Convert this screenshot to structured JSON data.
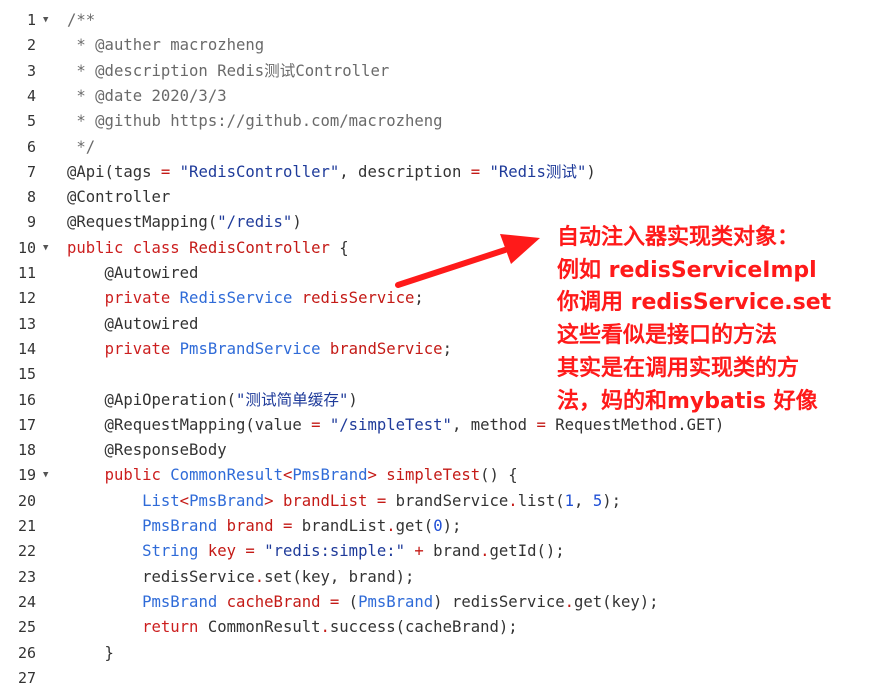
{
  "colors": {
    "keyword": "#cc1f1f",
    "type": "#2f6bd8",
    "string": "#1f3b9a",
    "comment": "#6a6a6a",
    "annotation_text": "#ff1a1a"
  },
  "code_lines": [
    {
      "num": "1",
      "fold": true,
      "tokens": [
        {
          "t": "/**",
          "c": "comment"
        }
      ]
    },
    {
      "num": "2",
      "fold": false,
      "tokens": [
        {
          "t": " * @auther macrozheng",
          "c": "comment"
        }
      ]
    },
    {
      "num": "3",
      "fold": false,
      "tokens": [
        {
          "t": " * @description Redis测试Controller",
          "c": "comment"
        }
      ]
    },
    {
      "num": "4",
      "fold": false,
      "tokens": [
        {
          "t": " * @date 2020/3/3",
          "c": "comment"
        }
      ]
    },
    {
      "num": "5",
      "fold": false,
      "tokens": [
        {
          "t": " * @github https://github.com/macrozheng",
          "c": "comment"
        }
      ]
    },
    {
      "num": "6",
      "fold": false,
      "tokens": [
        {
          "t": " */",
          "c": "comment"
        }
      ]
    },
    {
      "num": "7",
      "fold": false,
      "tokens": [
        {
          "t": "@Api(tags ",
          "c": "annot"
        },
        {
          "t": "=",
          "c": "cls"
        },
        {
          "t": " ",
          "c": "plain"
        },
        {
          "t": "\"RedisController\"",
          "c": "str"
        },
        {
          "t": ", description ",
          "c": "plain"
        },
        {
          "t": "=",
          "c": "cls"
        },
        {
          "t": " ",
          "c": "plain"
        },
        {
          "t": "\"Redis测试\"",
          "c": "str"
        },
        {
          "t": ")",
          "c": "plain"
        }
      ]
    },
    {
      "num": "8",
      "fold": false,
      "tokens": [
        {
          "t": "@Controller",
          "c": "annot"
        }
      ]
    },
    {
      "num": "9",
      "fold": false,
      "tokens": [
        {
          "t": "@RequestMapping(",
          "c": "annot"
        },
        {
          "t": "\"/redis\"",
          "c": "str"
        },
        {
          "t": ")",
          "c": "plain"
        }
      ]
    },
    {
      "num": "10",
      "fold": true,
      "tokens": [
        {
          "t": "public",
          "c": "kw"
        },
        {
          "t": " ",
          "c": "plain"
        },
        {
          "t": "class",
          "c": "kw"
        },
        {
          "t": " ",
          "c": "plain"
        },
        {
          "t": "RedisController",
          "c": "cls"
        },
        {
          "t": " {",
          "c": "plain"
        }
      ]
    },
    {
      "num": "11",
      "fold": false,
      "tokens": [
        {
          "t": "    @Autowired",
          "c": "annot"
        }
      ]
    },
    {
      "num": "12",
      "fold": false,
      "tokens": [
        {
          "t": "    ",
          "c": "plain"
        },
        {
          "t": "private",
          "c": "kw"
        },
        {
          "t": " ",
          "c": "plain"
        },
        {
          "t": "RedisService",
          "c": "type"
        },
        {
          "t": " ",
          "c": "plain"
        },
        {
          "t": "redisService",
          "c": "field"
        },
        {
          "t": ";",
          "c": "plain"
        }
      ]
    },
    {
      "num": "13",
      "fold": false,
      "tokens": [
        {
          "t": "    @Autowired",
          "c": "annot"
        }
      ]
    },
    {
      "num": "14",
      "fold": false,
      "tokens": [
        {
          "t": "    ",
          "c": "plain"
        },
        {
          "t": "private",
          "c": "kw"
        },
        {
          "t": " ",
          "c": "plain"
        },
        {
          "t": "PmsBrandService",
          "c": "type"
        },
        {
          "t": " ",
          "c": "plain"
        },
        {
          "t": "brandService",
          "c": "field"
        },
        {
          "t": ";",
          "c": "plain"
        }
      ]
    },
    {
      "num": "15",
      "fold": false,
      "tokens": []
    },
    {
      "num": "16",
      "fold": false,
      "tokens": [
        {
          "t": "    @ApiOperation(",
          "c": "annot"
        },
        {
          "t": "\"测试简单缓存\"",
          "c": "str"
        },
        {
          "t": ")",
          "c": "plain"
        }
      ]
    },
    {
      "num": "17",
      "fold": false,
      "tokens": [
        {
          "t": "    @RequestMapping(value ",
          "c": "annot"
        },
        {
          "t": "=",
          "c": "cls"
        },
        {
          "t": " ",
          "c": "plain"
        },
        {
          "t": "\"/simpleTest\"",
          "c": "str"
        },
        {
          "t": ", method ",
          "c": "plain"
        },
        {
          "t": "=",
          "c": "cls"
        },
        {
          "t": " RequestMethod.GET)",
          "c": "plain"
        }
      ]
    },
    {
      "num": "18",
      "fold": false,
      "tokens": [
        {
          "t": "    @ResponseBody",
          "c": "annot"
        }
      ]
    },
    {
      "num": "19",
      "fold": true,
      "tokens": [
        {
          "t": "    ",
          "c": "plain"
        },
        {
          "t": "public",
          "c": "kw"
        },
        {
          "t": " ",
          "c": "plain"
        },
        {
          "t": "CommonResult",
          "c": "type"
        },
        {
          "t": "<",
          "c": "cls"
        },
        {
          "t": "PmsBrand",
          "c": "type"
        },
        {
          "t": ">",
          "c": "cls"
        },
        {
          "t": " ",
          "c": "plain"
        },
        {
          "t": "simpleTest",
          "c": "method"
        },
        {
          "t": "() {",
          "c": "plain"
        }
      ]
    },
    {
      "num": "20",
      "fold": false,
      "tokens": [
        {
          "t": "        ",
          "c": "plain"
        },
        {
          "t": "List",
          "c": "type"
        },
        {
          "t": "<",
          "c": "cls"
        },
        {
          "t": "PmsBrand",
          "c": "type"
        },
        {
          "t": ">",
          "c": "cls"
        },
        {
          "t": " ",
          "c": "plain"
        },
        {
          "t": "brandList",
          "c": "field"
        },
        {
          "t": " ",
          "c": "plain"
        },
        {
          "t": "=",
          "c": "cls"
        },
        {
          "t": " brandService",
          "c": "plain"
        },
        {
          "t": ".",
          "c": "cls"
        },
        {
          "t": "list(",
          "c": "plain"
        },
        {
          "t": "1",
          "c": "num"
        },
        {
          "t": ", ",
          "c": "plain"
        },
        {
          "t": "5",
          "c": "num"
        },
        {
          "t": ");",
          "c": "plain"
        }
      ]
    },
    {
      "num": "21",
      "fold": false,
      "tokens": [
        {
          "t": "        ",
          "c": "plain"
        },
        {
          "t": "PmsBrand",
          "c": "type"
        },
        {
          "t": " ",
          "c": "plain"
        },
        {
          "t": "brand",
          "c": "field"
        },
        {
          "t": " ",
          "c": "plain"
        },
        {
          "t": "=",
          "c": "cls"
        },
        {
          "t": " brandList",
          "c": "plain"
        },
        {
          "t": ".",
          "c": "cls"
        },
        {
          "t": "get(",
          "c": "plain"
        },
        {
          "t": "0",
          "c": "num"
        },
        {
          "t": ");",
          "c": "plain"
        }
      ]
    },
    {
      "num": "22",
      "fold": false,
      "tokens": [
        {
          "t": "        ",
          "c": "plain"
        },
        {
          "t": "String",
          "c": "type"
        },
        {
          "t": " ",
          "c": "plain"
        },
        {
          "t": "key",
          "c": "field"
        },
        {
          "t": " ",
          "c": "plain"
        },
        {
          "t": "=",
          "c": "cls"
        },
        {
          "t": " ",
          "c": "plain"
        },
        {
          "t": "\"redis:simple:\"",
          "c": "str"
        },
        {
          "t": " ",
          "c": "plain"
        },
        {
          "t": "+",
          "c": "cls"
        },
        {
          "t": " brand",
          "c": "plain"
        },
        {
          "t": ".",
          "c": "cls"
        },
        {
          "t": "getId();",
          "c": "plain"
        }
      ]
    },
    {
      "num": "23",
      "fold": false,
      "tokens": [
        {
          "t": "        redisService",
          "c": "plain"
        },
        {
          "t": ".",
          "c": "cls"
        },
        {
          "t": "set(key, brand);",
          "c": "plain"
        }
      ]
    },
    {
      "num": "24",
      "fold": false,
      "tokens": [
        {
          "t": "        ",
          "c": "plain"
        },
        {
          "t": "PmsBrand",
          "c": "type"
        },
        {
          "t": " ",
          "c": "plain"
        },
        {
          "t": "cacheBrand",
          "c": "field"
        },
        {
          "t": " ",
          "c": "plain"
        },
        {
          "t": "=",
          "c": "cls"
        },
        {
          "t": " (",
          "c": "plain"
        },
        {
          "t": "PmsBrand",
          "c": "type"
        },
        {
          "t": ") redisService",
          "c": "plain"
        },
        {
          "t": ".",
          "c": "cls"
        },
        {
          "t": "get(key);",
          "c": "plain"
        }
      ]
    },
    {
      "num": "25",
      "fold": false,
      "tokens": [
        {
          "t": "        ",
          "c": "plain"
        },
        {
          "t": "return",
          "c": "kw"
        },
        {
          "t": " CommonResult",
          "c": "plain"
        },
        {
          "t": ".",
          "c": "cls"
        },
        {
          "t": "success(cacheBrand);",
          "c": "plain"
        }
      ]
    },
    {
      "num": "26",
      "fold": false,
      "tokens": [
        {
          "t": "    }",
          "c": "plain"
        }
      ]
    },
    {
      "num": "27",
      "fold": false,
      "tokens": []
    }
  ],
  "annotation": {
    "lines": [
      "自动注入器实现类对象：",
      "例如 redisServiceImpl",
      "你调用 redisService.set",
      "这些看似是接口的方法",
      "其实是在调用实现类的方",
      "法，妈的和mybatis 好像"
    ]
  }
}
